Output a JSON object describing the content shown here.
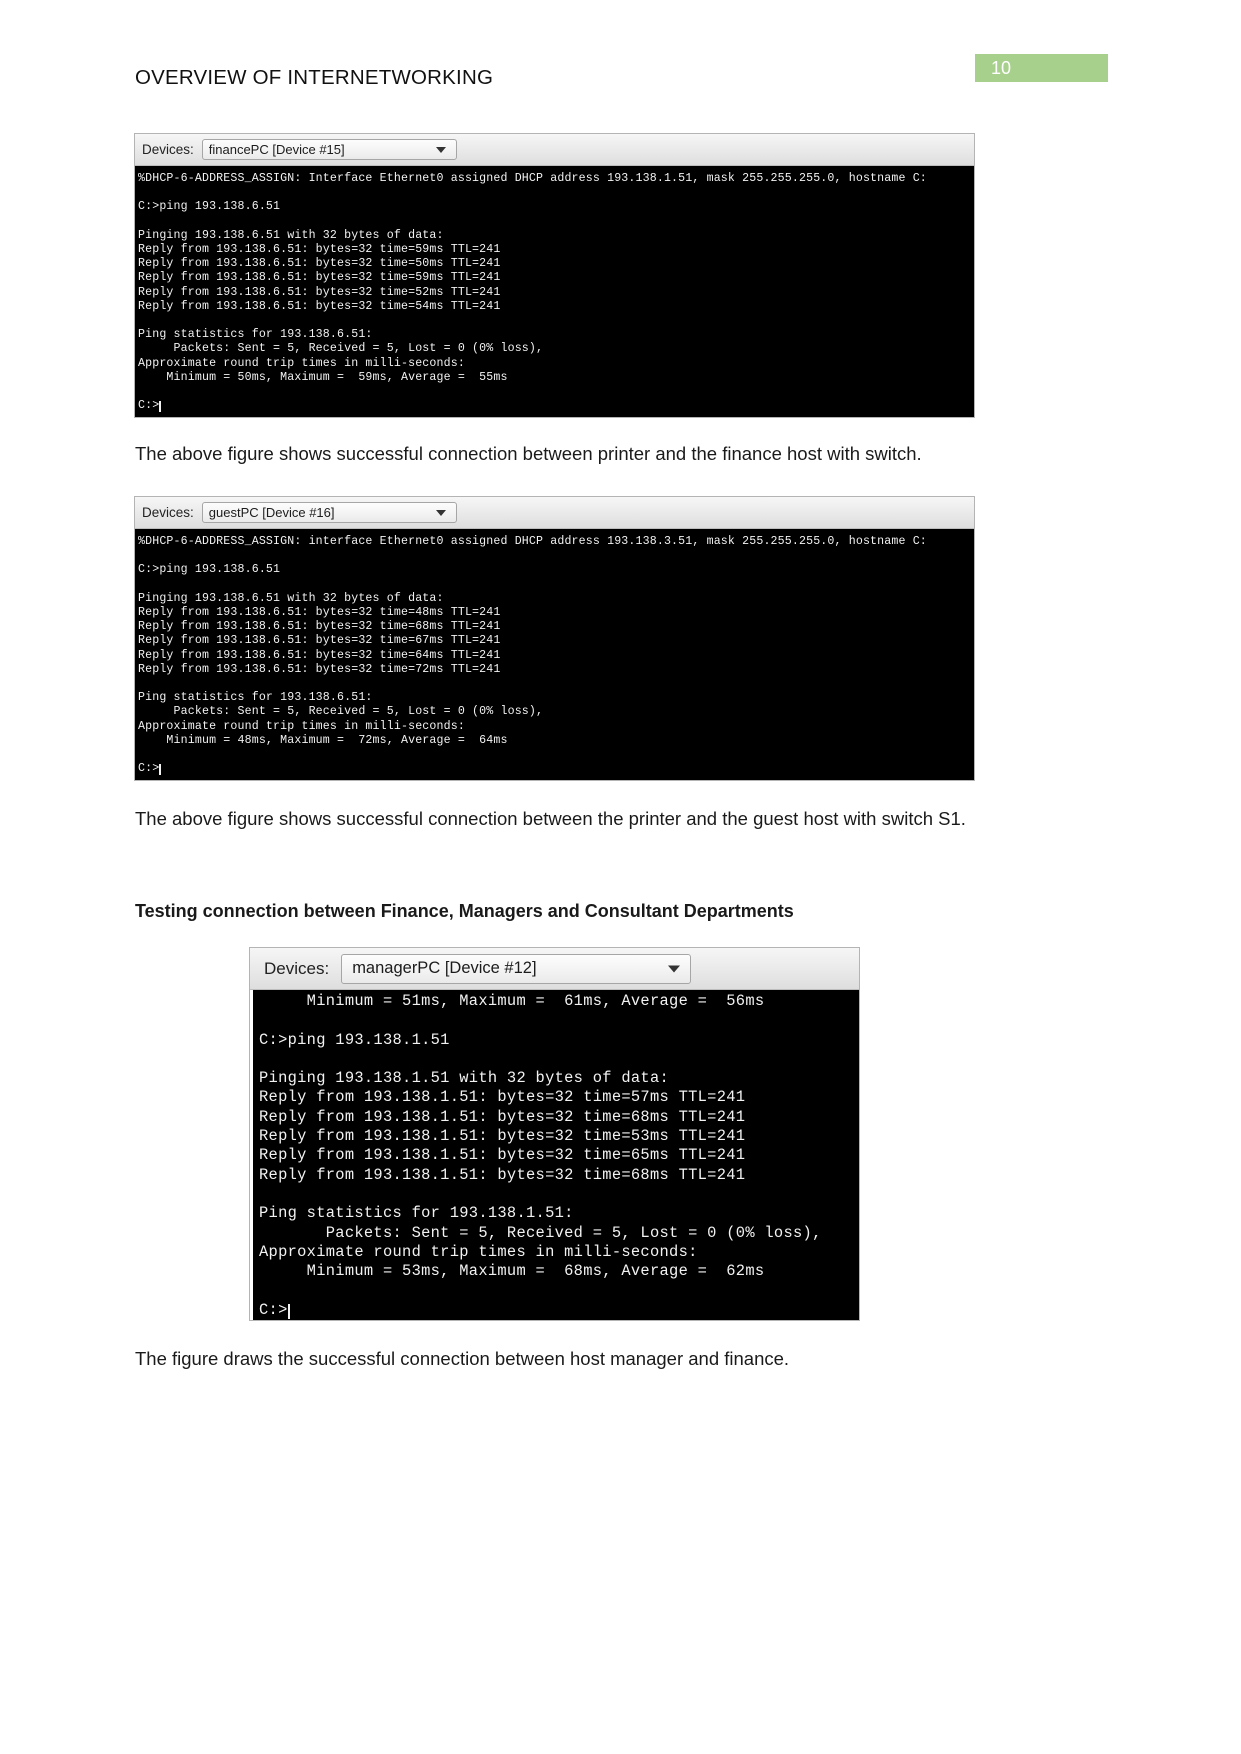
{
  "header": {
    "title": "OVERVIEW OF INTERNETWORKING",
    "page_number": "10",
    "badge_color": "#a8d08d"
  },
  "terminals": [
    {
      "id": "finance",
      "devices_label": "Devices:",
      "selected_device": "financePC [Device #15]",
      "caret_icon": "chevron-down-icon",
      "lines": [
        "%DHCP-6-ADDRESS_ASSIGN: Interface Ethernet0 assigned DHCP address 193.138.1.51, mask 255.255.255.0, hostname C:",
        "",
        "C:>ping 193.138.6.51",
        "",
        "Pinging 193.138.6.51 with 32 bytes of data:",
        "Reply from 193.138.6.51: bytes=32 time=59ms TTL=241",
        "Reply from 193.138.6.51: bytes=32 time=50ms TTL=241",
        "Reply from 193.138.6.51: bytes=32 time=59ms TTL=241",
        "Reply from 193.138.6.51: bytes=32 time=52ms TTL=241",
        "Reply from 193.138.6.51: bytes=32 time=54ms TTL=241",
        "",
        "Ping statistics for 193.138.6.51:",
        "     Packets: Sent = 5, Received = 5, Lost = 0 (0% loss),",
        "Approximate round trip times in milli-seconds:",
        "    Minimum = 50ms, Maximum =  59ms, Average =  55ms",
        "",
        "C:>"
      ]
    },
    {
      "id": "guest",
      "devices_label": "Devices:",
      "selected_device": "guestPC [Device #16]",
      "caret_icon": "chevron-down-icon",
      "lines": [
        "%DHCP-6-ADDRESS_ASSIGN: interface Ethernet0 assigned DHCP address 193.138.3.51, mask 255.255.255.0, hostname C:",
        "",
        "C:>ping 193.138.6.51",
        "",
        "Pinging 193.138.6.51 with 32 bytes of data:",
        "Reply from 193.138.6.51: bytes=32 time=48ms TTL=241",
        "Reply from 193.138.6.51: bytes=32 time=68ms TTL=241",
        "Reply from 193.138.6.51: bytes=32 time=67ms TTL=241",
        "Reply from 193.138.6.51: bytes=32 time=64ms TTL=241",
        "Reply from 193.138.6.51: bytes=32 time=72ms TTL=241",
        "",
        "Ping statistics for 193.138.6.51:",
        "     Packets: Sent = 5, Received = 5, Lost = 0 (0% loss),",
        "Approximate round trip times in milli-seconds:",
        "    Minimum = 48ms, Maximum =  72ms, Average =  64ms",
        "",
        "C:>"
      ]
    },
    {
      "id": "manager",
      "devices_label": "Devices:",
      "selected_device": "managerPC [Device #12]",
      "caret_icon": "chevron-down-icon",
      "lines": [
        "     Minimum = 51ms, Maximum =  61ms, Average =  56ms",
        "",
        "C:>ping 193.138.1.51",
        "",
        "Pinging 193.138.1.51 with 32 bytes of data:",
        "Reply from 193.138.1.51: bytes=32 time=57ms TTL=241",
        "Reply from 193.138.1.51: bytes=32 time=68ms TTL=241",
        "Reply from 193.138.1.51: bytes=32 time=53ms TTL=241",
        "Reply from 193.138.1.51: bytes=32 time=65ms TTL=241",
        "Reply from 193.138.1.51: bytes=32 time=68ms TTL=241",
        "",
        "Ping statistics for 193.138.1.51:",
        "       Packets: Sent = 5, Received = 5, Lost = 0 (0% loss),",
        "Approximate round trip times in milli-seconds:",
        "     Minimum = 53ms, Maximum =  68ms, Average =  62ms",
        "",
        "C:>"
      ]
    }
  ],
  "body": {
    "caption_finance": "The above figure shows successful connection between printer and the finance host with switch.",
    "caption_guest": "The above figure shows successful connection between the printer and the guest host with  switch S1.",
    "section_heading": "Testing connection between Finance, Managers and Consultant Departments",
    "caption_manager": "The figure draws the successful connection between host manager and finance."
  }
}
